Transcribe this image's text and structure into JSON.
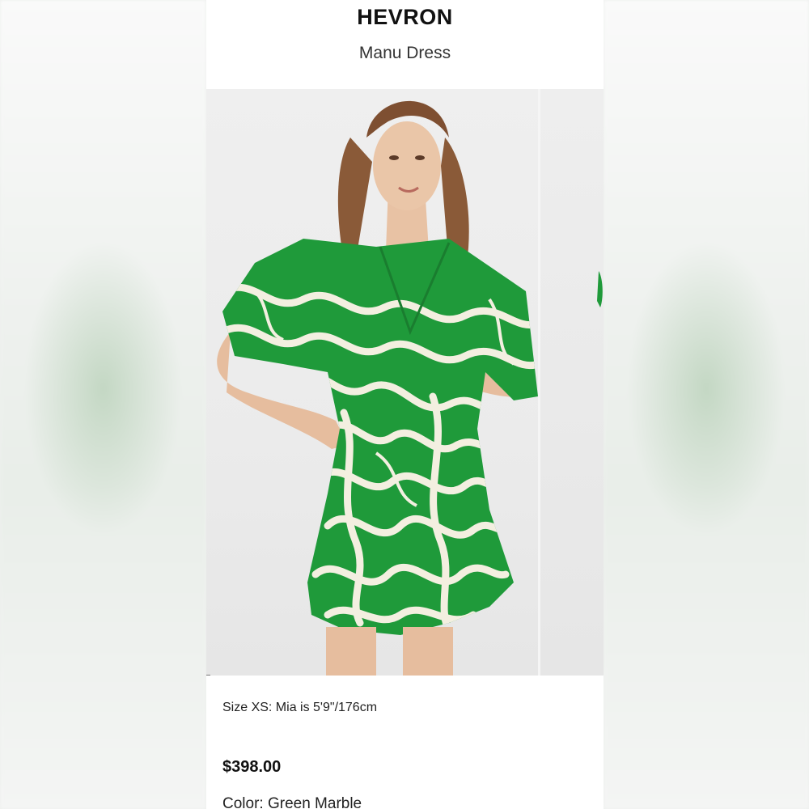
{
  "header": {
    "brand": "HEVRON",
    "product_name": "Manu Dress"
  },
  "gallery": {
    "image_alt": "model-wearing-green-swirl-print-wrap-dress",
    "accent_color": "#1f9a3a",
    "print_cream": "#f3efe0"
  },
  "details": {
    "size_note": "Size XS: Mia is 5'9\"/176cm",
    "price": "$398.00",
    "color": "Color: Green Marble"
  }
}
